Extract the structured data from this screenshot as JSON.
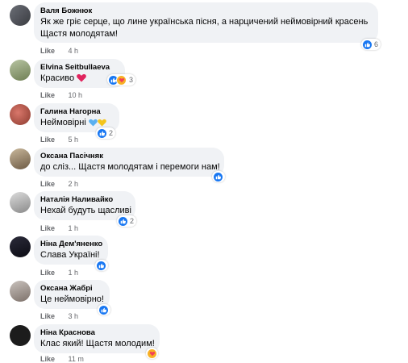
{
  "comments": [
    {
      "author": "Валя Божнюк",
      "text": "Як же гріє серце, що лине українська пісня, а нарцичений неймовірний красень",
      "text2": "Щастя молодятам!",
      "like": "Like",
      "time": "4 h",
      "reactions": "6"
    },
    {
      "author": "Elvina Seitbullaeva",
      "text": "Красиво",
      "like": "Like",
      "time": "10 h",
      "reactions": "3"
    },
    {
      "author": "Галина Нагорна",
      "text": "Неймовірні",
      "like": "Like",
      "time": "5 h",
      "reactions": "2"
    },
    {
      "author": "Оксана Пасічняк",
      "text": "до сліз... Щастя молодятам і перемоги нам!",
      "like": "Like",
      "time": "2 h",
      "reactions": ""
    },
    {
      "author": "Наталія Наливайко",
      "text": "Нехай будуть щасливі",
      "like": "Like",
      "time": "1 h",
      "reactions": "2"
    },
    {
      "author": "Ніна Дем'яненко",
      "text": "Слава Україні!",
      "like": "Like",
      "time": "1 h",
      "reactions": ""
    },
    {
      "author": "Оксана Жабрі",
      "text": "Це неймовірно!",
      "like": "Like",
      "time": "3 h",
      "reactions": ""
    },
    {
      "author": "Ніна Краснова",
      "text": "Клас який! Щастя молодим!",
      "like": "Like",
      "time": "11 m",
      "reactions": ""
    }
  ],
  "colors": {
    "like_blue": "#1877f2",
    "heart_red": "#f33e58",
    "bubble_bg": "#f0f2f5",
    "meta_gray": "#65676b"
  }
}
